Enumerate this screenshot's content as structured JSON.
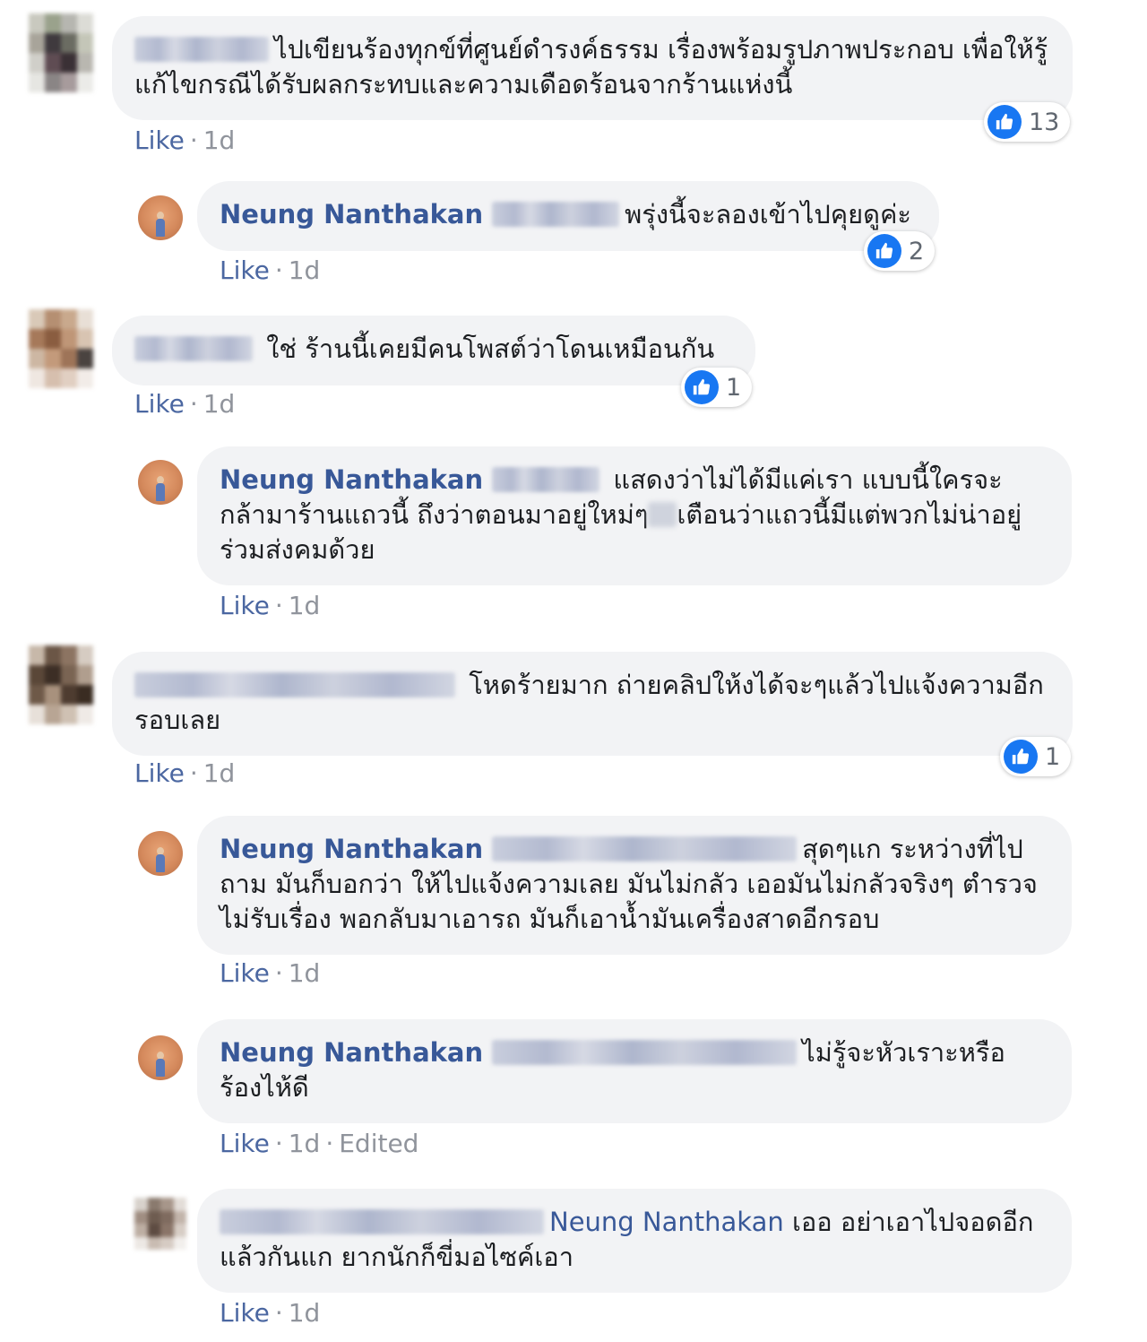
{
  "comments": [
    {
      "text": "ไปเขียนร้องทุกข์ที่ศูนย์ดำรงค์ธรรม เรื่องพร้อมรูปภาพประกอบ เพื่อให้รู้แก้ไขกรณีได้รับผลกระทบและความเดือดร้อนจากร้านแห่งนี้",
      "like": "Like",
      "time": "1d",
      "reactions": "13"
    },
    {
      "author": "Neung Nanthakan",
      "text": "พรุ่งนี้จะลองเข้าไปคุยดูค่ะ",
      "like": "Like",
      "time": "1d",
      "reactions": "2"
    },
    {
      "text": "ใช่ ร้านนี้เคยมีคนโพสต์ว่าโดนเหมือนกัน",
      "like": "Like",
      "time": "1d",
      "reactions": "1"
    },
    {
      "author": "Neung Nanthakan",
      "text_a": "แสดงว่าไม่ได้มีแค่เรา แบบนี้ใครจะกล้ามาร้านแถวนี้ ถึงว่าตอนมาอยู่ใหม่ๆ",
      "text_b": "เตือนว่าแถวนี้มีแต่พวกไม่น่าอยู่ร่วมส่งคมด้วย",
      "like": "Like",
      "time": "1d"
    },
    {
      "text": "โหดร้ายมาก ถ่ายคลิปให้งได้จะๆแล้วไปแจ้งความอีกรอบเลย",
      "like": "Like",
      "time": "1d",
      "reactions": "1"
    },
    {
      "author": "Neung Nanthakan",
      "text": "สุดๆแก ระหว่างที่ไปถาม มันก็บอกว่า ให้ไปแจ้งความเลย มันไม่กลัว เออมันไม่กลัวจริงๆ ตำรวจไม่รับเรื่อง พอกลับมาเอารถ มันก็เอาน้ำมันเครื่องสาดอีกรอบ",
      "like": "Like",
      "time": "1d"
    },
    {
      "author": "Neung Nanthakan",
      "text": "ไม่รู้จะหัวเราะหรือร้องไห้ดี",
      "like": "Like",
      "time": "1d",
      "edited": "Edited"
    },
    {
      "mention": "Neung Nanthakan",
      "text": "เออ อย่าเอาไปจอดอีกแล้วกันแก ยากนักก็ขี่มอไซค์เอา",
      "like": "Like",
      "time": "1d"
    }
  ],
  "colors": {
    "bubble": "#f2f3f5",
    "author": "#385898",
    "like": "#4b67a1",
    "meta": "#90949c",
    "reaction": "#1877f2"
  },
  "icons": {
    "reaction": "like-thumb-icon"
  }
}
